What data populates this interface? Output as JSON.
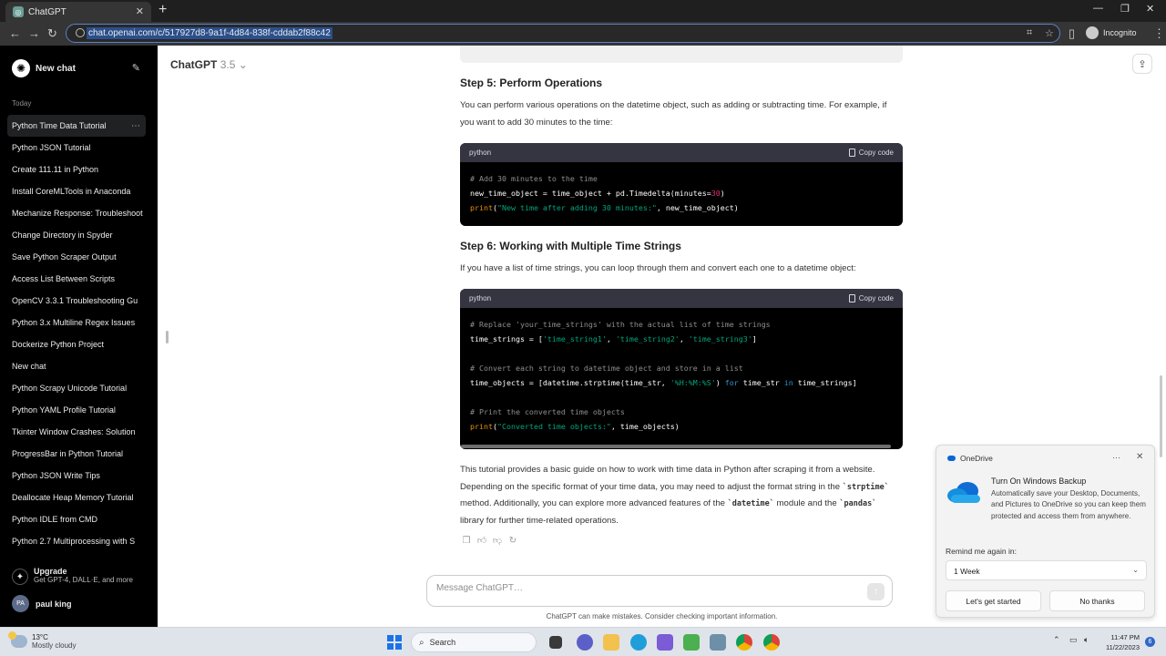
{
  "browser": {
    "tab_title": "ChatGPT",
    "url": "chat.openai.com/c/517927d8-9a1f-4d84-838f-cddab2f88c42",
    "profile_label": "Incognito"
  },
  "sidebar": {
    "new_chat_label": "New chat",
    "section_today": "Today",
    "items": [
      {
        "label": "Python Time Data Tutorial"
      },
      {
        "label": "Python JSON Tutorial"
      },
      {
        "label": "Create 111.11 in Python"
      },
      {
        "label": "Install CoreMLTools in Anaconda"
      },
      {
        "label": "Mechanize Response: Troubleshoot"
      },
      {
        "label": "Change Directory in Spyder"
      },
      {
        "label": "Save Python Scraper Output"
      },
      {
        "label": "Access List Between Scripts"
      },
      {
        "label": "OpenCV 3.3.1 Troubleshooting Gu"
      },
      {
        "label": "Python 3.x Multiline Regex Issues"
      },
      {
        "label": "Dockerize Python Project"
      },
      {
        "label": "New chat"
      },
      {
        "label": "Python Scrapy Unicode Tutorial"
      },
      {
        "label": "Python YAML Profile Tutorial"
      },
      {
        "label": "Tkinter Window Crashes: Solution"
      },
      {
        "label": "ProgressBar in Python Tutorial"
      },
      {
        "label": "Python JSON Write Tips"
      },
      {
        "label": "Deallocate Heap Memory Tutorial"
      },
      {
        "label": "Python IDLE from CMD"
      },
      {
        "label": "Python 2.7 Multiprocessing with S"
      }
    ],
    "upgrade_title": "Upgrade",
    "upgrade_subtitle": "Get GPT-4, DALL·E, and more",
    "user_initials": "PA",
    "user_name": "paul king"
  },
  "header": {
    "model_name": "ChatGPT",
    "model_version": "3.5"
  },
  "content": {
    "step5_title": "Step 5: Perform Operations",
    "step5_text": "You can perform various operations on the datetime object, such as adding or subtracting time. For example, if you want to add 30 minutes to the time:",
    "code_lang": "python",
    "copy_label": "Copy code",
    "code1": {
      "line1": "# Add 30 minutes to the time",
      "line2a": "new_time_object = time_object + pd.Timedelta(minutes=",
      "line2num": "30",
      "line2b": ")",
      "line3fn": "print",
      "line3a": "(",
      "line3str": "\"New time after adding 30 minutes:\"",
      "line3b": ", new_time_object)"
    },
    "step6_title": "Step 6: Working with Multiple Time Strings",
    "step6_text": "If you have a list of time strings, you can loop through them and convert each one to a datetime object:",
    "code2": {
      "c1": "# Replace 'your_time_strings' with the actual list of time strings",
      "l2a": "time_strings = [",
      "l2s1": "'time_string1'",
      "l2c1": ", ",
      "l2s2": "'time_string2'",
      "l2c2": ", ",
      "l2s3": "'time_string3'",
      "l2b": "]",
      "c2": "# Convert each string to datetime object and store in a list",
      "l4a": "time_objects = [datetime.strptime(time_str, ",
      "l4s": "'%H:%M:%S'",
      "l4b": ") ",
      "l4k1": "for",
      "l4c": " time_str ",
      "l4k2": "in",
      "l4d": " time_strings]",
      "c3": "# Print the converted time objects",
      "l6fn": "print",
      "l6a": "(",
      "l6s": "\"Converted time objects:\"",
      "l6b": ", time_objects)"
    },
    "summary_p1": "This tutorial provides a basic guide on how to work with time data in Python after scraping it from a website. Depending on the specific format of your time data, you may need to adjust the format string in the ",
    "summary_code1": "`strptime`",
    "summary_p2": " method. Additionally, you can explore more advanced features of the ",
    "summary_code2": "`datetime`",
    "summary_p3": " module and the ",
    "summary_code3": "`pandas`",
    "summary_p4": " library for further time-related operations."
  },
  "composer": {
    "placeholder": "Message ChatGPT…",
    "disclaimer": "ChatGPT can make mistakes. Consider checking important information."
  },
  "toast": {
    "app_name": "OneDrive",
    "title": "Turn On Windows Backup",
    "body": "Automatically save your Desktop, Documents, and Pictures to OneDrive so you can keep them protected and access them from anywhere.",
    "remind_label": "Remind me again in:",
    "remind_value": "1 Week",
    "primary_button": "Let's get started",
    "secondary_button": "No thanks"
  },
  "taskbar": {
    "temperature": "13°C",
    "weather": "Mostly cloudy",
    "search_label": "Search",
    "time": "11:47 PM",
    "date": "11/22/2023",
    "notification_count": "6"
  },
  "colors": {
    "sidebar_bg": "#000000",
    "code_bg": "#000000",
    "accent_blue": "#1a73e8"
  }
}
